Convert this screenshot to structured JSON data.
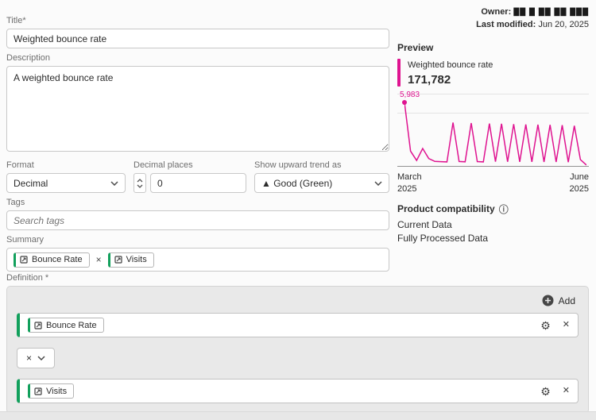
{
  "header": {
    "owner_label": "Owner:",
    "owner_value": "██ █ ██ ██ ███",
    "last_modified_label": "Last modified:",
    "last_modified_value": "Jun 20, 2025"
  },
  "form": {
    "title": {
      "label": "Title*",
      "value": "Weighted bounce rate"
    },
    "description": {
      "label": "Description",
      "value": "A weighted bounce rate"
    },
    "format": {
      "label": "Format",
      "value": "Decimal"
    },
    "decimal_places": {
      "label": "Decimal places",
      "value": "0"
    },
    "trend": {
      "label": "Show upward trend as",
      "value": "▲ Good (Green)"
    },
    "tags": {
      "label": "Tags",
      "placeholder": "Search tags"
    },
    "summary": {
      "label": "Summary",
      "items": [
        "Bounce Rate",
        "Visits"
      ],
      "operator": "×"
    }
  },
  "definition": {
    "label": "Definition *",
    "add_label": "Add",
    "operator": "×",
    "rows": [
      {
        "label": "Bounce Rate"
      },
      {
        "label": "Visits"
      }
    ]
  },
  "preview": {
    "label": "Preview",
    "metric_title": "Weighted bounce rate",
    "metric_value": "171,782",
    "point_label": "5,983",
    "x_start": {
      "month": "March",
      "year": "2025"
    },
    "x_end": {
      "month": "June",
      "year": "2025"
    }
  },
  "compatibility": {
    "label": "Product compatibility",
    "items": [
      "Current Data",
      "Fully Processed Data"
    ]
  },
  "colors": {
    "accent_green": "#12a05c",
    "accent_magenta": "#df1390"
  },
  "chart_data": {
    "type": "line",
    "title": "Weighted bounce rate",
    "current_value": 171782,
    "first_point_label": "5,983",
    "x_range": [
      "March 2025",
      "June 2025"
    ],
    "ylim": [
      0,
      6400
    ],
    "grid": true,
    "line_color": "#df1390",
    "values": [
      5983,
      1400,
      520,
      1650,
      700,
      430,
      400,
      380,
      4100,
      420,
      390,
      4050,
      410,
      380,
      4000,
      400,
      3980,
      390,
      3950,
      385,
      3920,
      380,
      3900,
      375,
      3880,
      370,
      3850,
      360,
      3800,
      600,
      80
    ]
  }
}
